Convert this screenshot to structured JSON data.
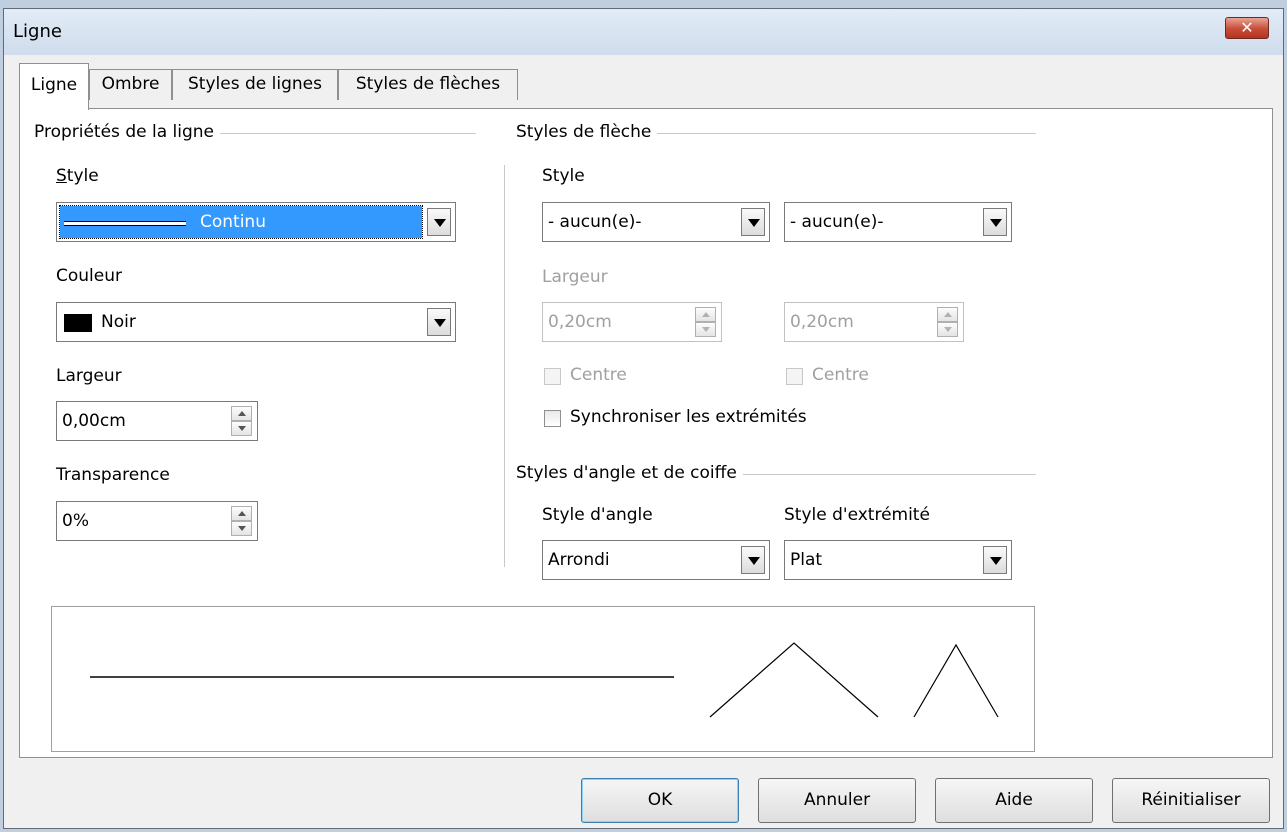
{
  "window": {
    "title": "Ligne",
    "close_symbol": "✕"
  },
  "tabs": [
    {
      "label": "Ligne",
      "active": true
    },
    {
      "label": "Ombre",
      "active": false
    },
    {
      "label": "Styles de lignes",
      "active": false
    },
    {
      "label": "Styles de flèches",
      "active": false
    }
  ],
  "line_properties": {
    "group_title": "Propriétés de la ligne",
    "style_label": "Style",
    "style_value": "Continu",
    "color_label": "Couleur",
    "color_value": "Noir",
    "color_swatch": "#000000",
    "width_label": "Largeur",
    "width_value": "0,00cm",
    "transparency_label": "Transparence",
    "transparency_value": "0%"
  },
  "arrow_styles": {
    "group_title": "Styles de flèche",
    "style_label": "Style",
    "start_style": "- aucun(e)-",
    "end_style": "- aucun(e)-",
    "width_label": "Largeur",
    "start_width": "0,20cm",
    "end_width": "0,20cm",
    "center_start_label": "Centre",
    "center_end_label": "Centre",
    "sync_label": "Synchroniser les extrémités"
  },
  "corner_cap": {
    "group_title": "Styles d'angle et de coiffe",
    "corner_label": "Style d'angle",
    "corner_value": "Arrondi",
    "cap_label": "Style d'extrémité",
    "cap_value": "Plat"
  },
  "buttons": {
    "ok": "OK",
    "cancel": "Annuler",
    "help": "Aide",
    "reset": "Réinitialiser"
  },
  "colors": {
    "selection": "#3399ff",
    "title_gradient_top": "#e2ecf7",
    "close_red": "#c74c36"
  }
}
